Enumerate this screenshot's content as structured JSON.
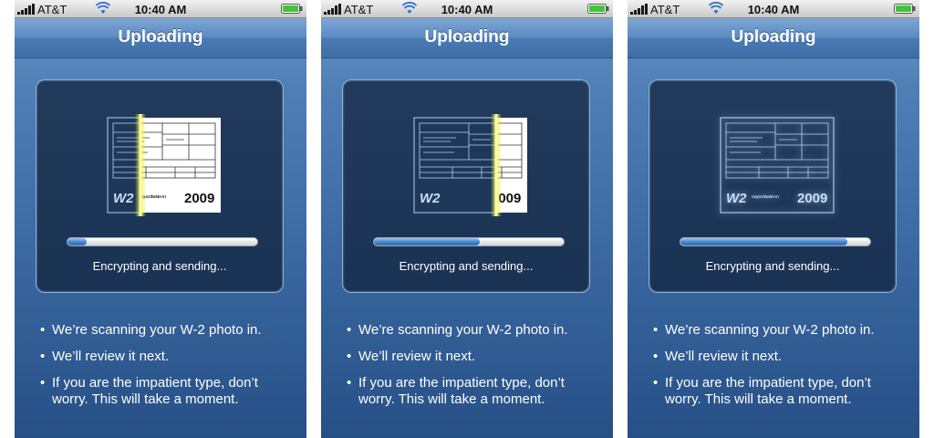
{
  "status_bar": {
    "carrier": "AT&T",
    "time": "10:40 AM"
  },
  "nav": {
    "title": "Uploading"
  },
  "panel": {
    "caption": "Encrypting and sending..."
  },
  "document": {
    "form_label": "W2",
    "year": "2009",
    "subtitle": "Wage and Tax Statement"
  },
  "bullets": [
    "We’re scanning your W-2 photo in.",
    "We’ll review it next.",
    "If you are the impatient type, don’t worry. This will take a moment."
  ],
  "screens": [
    {
      "progress": 0.1,
      "scan_state": "scan-left"
    },
    {
      "progress": 0.56,
      "scan_state": "scan-right"
    },
    {
      "progress": 0.88,
      "scan_state": "scanned"
    }
  ],
  "colors": {
    "accent": "#3f82cc",
    "nav": "#4a7ab4",
    "panel": "#1f3759",
    "glow": "#e8e83a"
  }
}
